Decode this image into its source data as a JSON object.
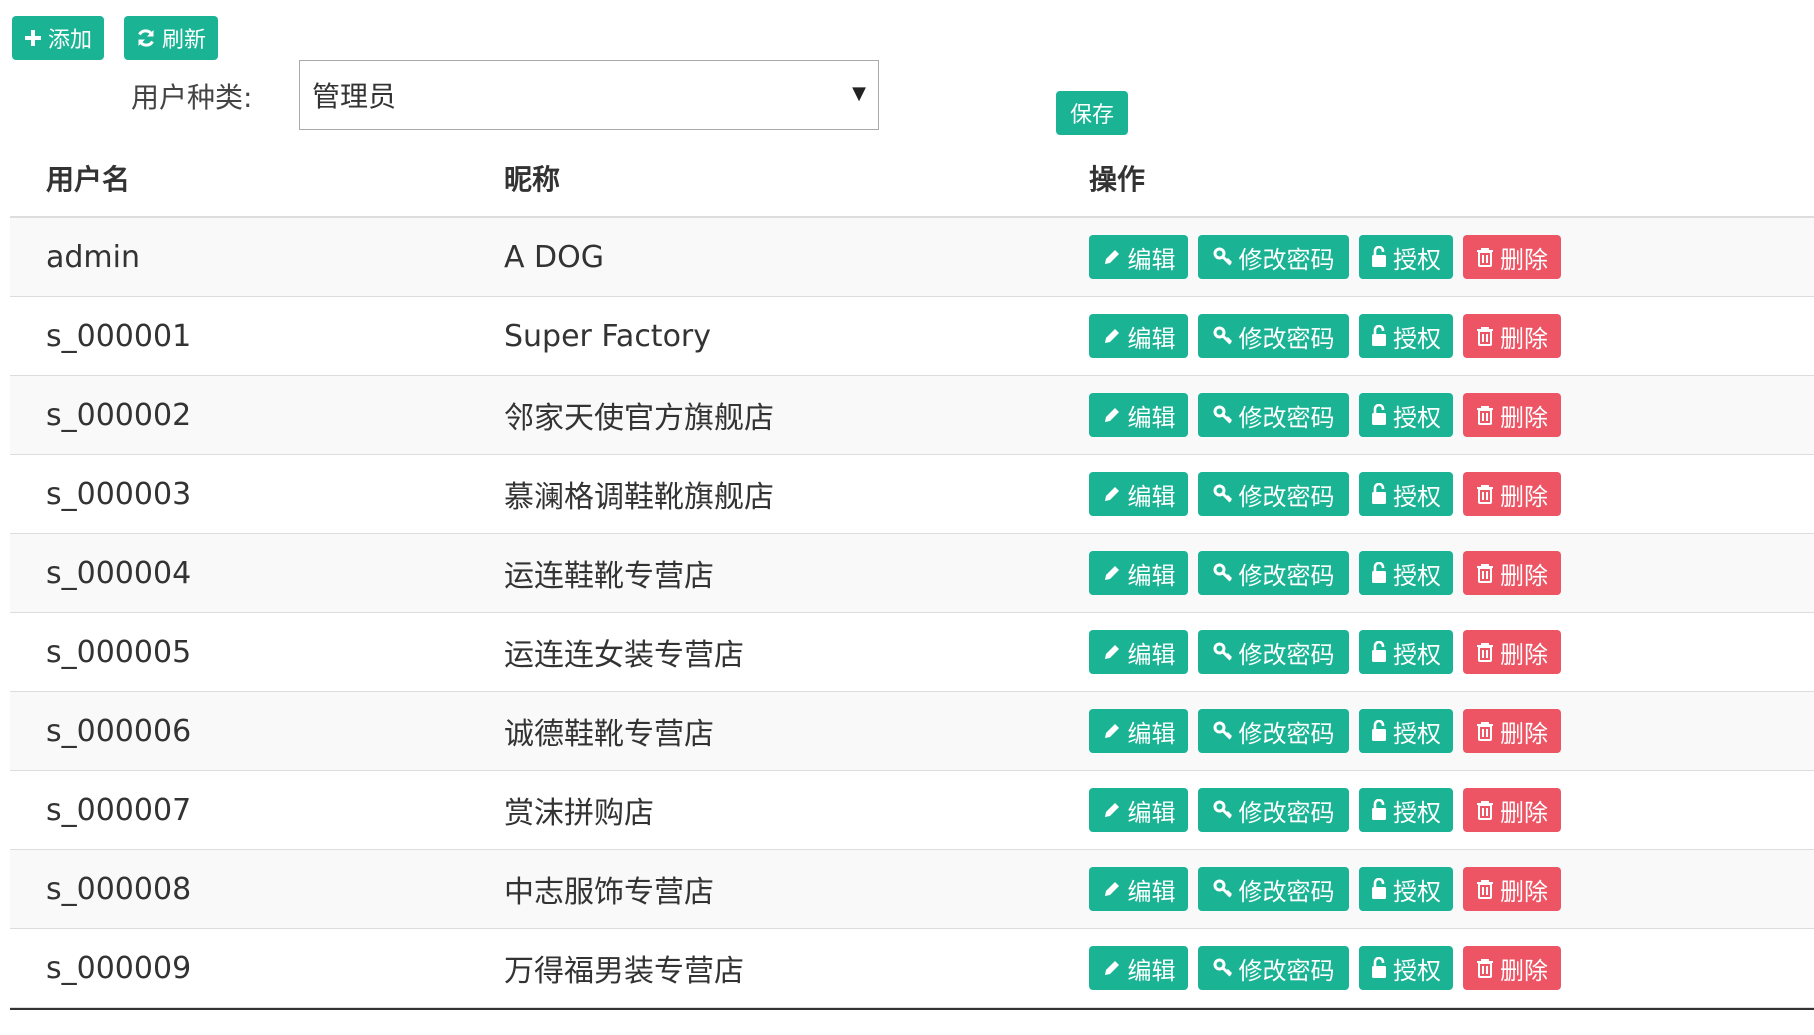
{
  "toolbar": {
    "add_label": "添加",
    "refresh_label": "刷新"
  },
  "filter": {
    "label": "用户种类:",
    "selected": "管理员",
    "save_label": "保存"
  },
  "columns": [
    "用户名",
    "昵称",
    "操作"
  ],
  "actions": {
    "edit": "编辑",
    "change_password": "修改密码",
    "authorize": "授权",
    "delete": "删除"
  },
  "rows": [
    {
      "username": "admin",
      "nickname": "A DOG"
    },
    {
      "username": "s_000001",
      "nickname": "Super Factory"
    },
    {
      "username": "s_000002",
      "nickname": "邻家天使官方旗舰店"
    },
    {
      "username": "s_000003",
      "nickname": "慕澜格调鞋靴旗舰店"
    },
    {
      "username": "s_000004",
      "nickname": "运连鞋靴专营店"
    },
    {
      "username": "s_000005",
      "nickname": "运连连女装专营店"
    },
    {
      "username": "s_000006",
      "nickname": "诚德鞋靴专营店"
    },
    {
      "username": "s_000007",
      "nickname": "赏沫拼购店"
    },
    {
      "username": "s_000008",
      "nickname": "中志服饰专营店"
    },
    {
      "username": "s_000009",
      "nickname": "万得福男装专营店"
    }
  ],
  "colors": {
    "primary": "#1ab394",
    "danger": "#ed5565"
  },
  "icons": {
    "add": "plus-icon",
    "refresh": "refresh-icon",
    "edit": "pencil-icon",
    "password": "key-icon",
    "authorize": "unlock-icon",
    "delete": "trash-icon"
  }
}
